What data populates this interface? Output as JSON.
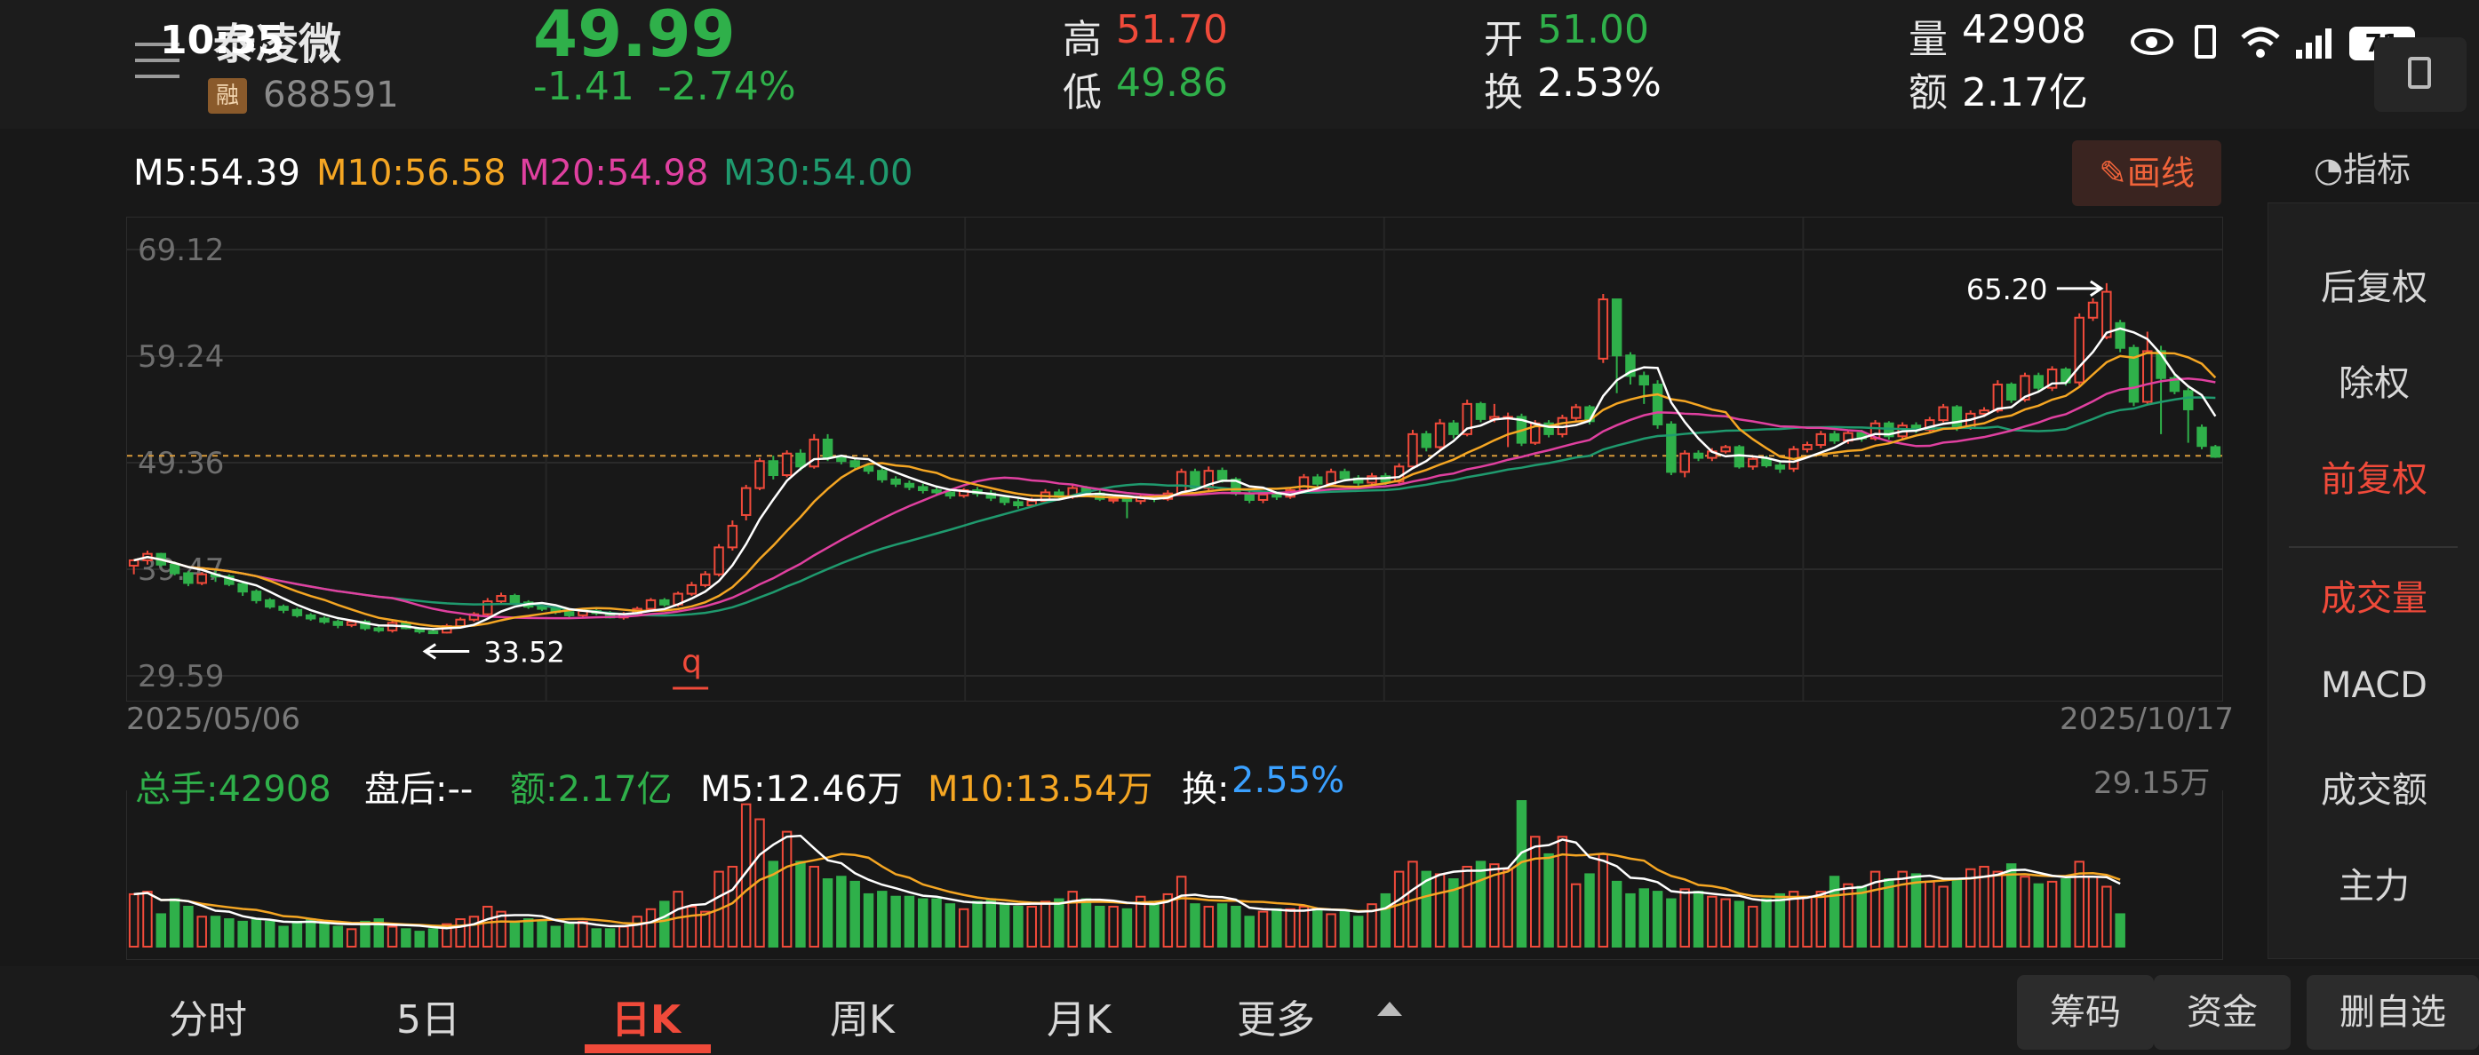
{
  "status_bar": {
    "time": "10:35",
    "battery": "71"
  },
  "stock": {
    "name": "泰凌微",
    "badge": "融",
    "code": "688591",
    "price": "49.99",
    "change": "-1.41",
    "change_pct": "-2.74%",
    "high_label": "高",
    "high": "51.70",
    "low_label": "低",
    "low": "49.86",
    "open_label": "开",
    "open": "51.00",
    "turnover_label": "换",
    "turnover": "2.53%",
    "volume_label": "量",
    "volume": "42908",
    "amount_label": "额",
    "amount": "2.17亿"
  },
  "ma_row": {
    "m5": "M5:54.39",
    "m10": "M10:56.58",
    "m20": "M20:54.98",
    "m30": "M30:54.00",
    "draw_btn": "画线",
    "indicator_btn": "指标"
  },
  "right_panel": [
    {
      "label": "后复权",
      "active": false
    },
    {
      "label": "除权",
      "active": false
    },
    {
      "label": "前复权",
      "active": true
    },
    {
      "label": "成交量",
      "active": true
    },
    {
      "label": "MACD",
      "active": false
    },
    {
      "label": "成交额",
      "active": false
    },
    {
      "label": "主力",
      "active": false
    }
  ],
  "chart_data": {
    "type": "candlestick",
    "y_ticks": [
      "69.12",
      "59.24",
      "49.36",
      "39.47",
      "29.59"
    ],
    "ylim": [
      29.59,
      69.12
    ],
    "start_date": "2025/05/06",
    "end_date": "2025/10/17",
    "max_label": "65.20",
    "min_label": "33.52",
    "marker_q": "q",
    "last_close": 49.99,
    "candles": [
      [
        39.8,
        40.3,
        39.0,
        40.4
      ],
      [
        40.3,
        40.9,
        39.9,
        41.2
      ],
      [
        40.9,
        39.9,
        39.7,
        41.0
      ],
      [
        39.9,
        39.1,
        38.9,
        40.2
      ],
      [
        39.1,
        38.2,
        37.9,
        39.3
      ],
      [
        38.2,
        39.0,
        38.0,
        39.2
      ],
      [
        39.0,
        38.8,
        38.3,
        39.4
      ],
      [
        38.8,
        38.1,
        37.9,
        39.0
      ],
      [
        38.1,
        37.4,
        37.0,
        38.3
      ],
      [
        37.4,
        36.6,
        36.3,
        37.6
      ],
      [
        36.6,
        36.0,
        35.8,
        36.8
      ],
      [
        36.0,
        35.7,
        35.4,
        36.2
      ],
      [
        35.7,
        35.2,
        35.0,
        35.9
      ],
      [
        35.2,
        34.9,
        34.7,
        35.4
      ],
      [
        34.9,
        34.6,
        34.4,
        35.1
      ],
      [
        34.6,
        34.3,
        34.0,
        34.8
      ],
      [
        34.3,
        34.6,
        34.1,
        34.8
      ],
      [
        34.6,
        34.0,
        33.8,
        34.8
      ],
      [
        34.0,
        33.8,
        33.6,
        34.2
      ],
      [
        33.8,
        34.5,
        33.6,
        34.7
      ],
      [
        34.5,
        34.0,
        33.9,
        34.7
      ],
      [
        34.0,
        33.7,
        33.5,
        34.1
      ],
      [
        33.7,
        33.6,
        33.5,
        33.9
      ],
      [
        33.6,
        34.2,
        33.52,
        34.4
      ],
      [
        34.2,
        34.8,
        34.0,
        35.0
      ],
      [
        34.8,
        35.3,
        34.6,
        35.5
      ],
      [
        35.3,
        36.5,
        35.1,
        36.8
      ],
      [
        36.5,
        37.0,
        36.2,
        37.3
      ],
      [
        37.0,
        36.4,
        36.2,
        37.2
      ],
      [
        36.4,
        36.0,
        35.8,
        36.6
      ],
      [
        36.0,
        35.8,
        35.6,
        36.2
      ],
      [
        35.8,
        35.5,
        35.3,
        36.0
      ],
      [
        35.5,
        35.2,
        35.0,
        35.7
      ],
      [
        35.2,
        35.6,
        35.0,
        35.8
      ],
      [
        35.6,
        35.4,
        35.2,
        35.8
      ],
      [
        35.4,
        35.0,
        34.9,
        35.6
      ],
      [
        35.0,
        35.3,
        34.8,
        35.5
      ],
      [
        35.3,
        35.8,
        35.1,
        36.0
      ],
      [
        35.8,
        36.6,
        35.6,
        36.8
      ],
      [
        36.6,
        36.2,
        36.0,
        36.8
      ],
      [
        36.2,
        37.2,
        36.0,
        37.4
      ],
      [
        37.2,
        38.0,
        37.0,
        38.3
      ],
      [
        38.0,
        39.0,
        37.8,
        39.3
      ],
      [
        39.0,
        41.5,
        38.8,
        41.8
      ],
      [
        41.5,
        43.5,
        41.2,
        44.0
      ],
      [
        44.5,
        47.0,
        44.0,
        47.3
      ],
      [
        47.0,
        49.5,
        46.8,
        49.8
      ],
      [
        49.5,
        48.2,
        47.8,
        50.0
      ],
      [
        48.2,
        50.2,
        48.0,
        50.5
      ],
      [
        50.2,
        49.0,
        48.6,
        50.6
      ],
      [
        49.0,
        51.5,
        48.8,
        52.0
      ],
      [
        51.5,
        49.8,
        49.5,
        52.0
      ],
      [
        49.8,
        49.5,
        49.2,
        50.1
      ],
      [
        49.5,
        49.0,
        48.8,
        49.8
      ],
      [
        49.0,
        48.6,
        48.3,
        49.3
      ],
      [
        48.6,
        47.8,
        47.5,
        48.9
      ],
      [
        47.8,
        47.4,
        47.1,
        48.1
      ],
      [
        47.4,
        47.1,
        46.8,
        47.7
      ],
      [
        47.1,
        46.8,
        46.5,
        47.4
      ],
      [
        46.8,
        46.6,
        46.3,
        47.1
      ],
      [
        46.6,
        46.3,
        46.0,
        46.9
      ],
      [
        46.3,
        46.8,
        46.1,
        47.0
      ],
      [
        46.8,
        46.5,
        46.2,
        47.1
      ],
      [
        46.5,
        46.1,
        45.8,
        46.8
      ],
      [
        46.1,
        45.7,
        45.4,
        46.3
      ],
      [
        45.7,
        45.4,
        45.1,
        46.0
      ],
      [
        45.4,
        45.8,
        45.2,
        46.1
      ],
      [
        45.8,
        46.6,
        45.6,
        46.9
      ],
      [
        46.6,
        46.2,
        46.0,
        46.9
      ],
      [
        46.2,
        47.0,
        46.0,
        47.3
      ],
      [
        47.0,
        46.5,
        46.2,
        47.2
      ],
      [
        46.5,
        46.0,
        45.8,
        46.8
      ],
      [
        46.0,
        46.0,
        45.6,
        46.3
      ],
      [
        46.0,
        45.8,
        44.2,
        46.1
      ],
      [
        45.8,
        46.2,
        45.5,
        46.4
      ],
      [
        46.2,
        46.0,
        45.7,
        46.4
      ],
      [
        46.0,
        46.5,
        45.8,
        46.8
      ],
      [
        46.5,
        48.5,
        46.3,
        48.8
      ],
      [
        48.5,
        47.0,
        46.8,
        48.8
      ],
      [
        47.0,
        48.6,
        46.8,
        49.0
      ],
      [
        48.6,
        47.8,
        47.5,
        48.9
      ],
      [
        47.8,
        46.5,
        46.3,
        48.0
      ],
      [
        46.5,
        45.9,
        45.6,
        46.8
      ],
      [
        45.9,
        46.4,
        45.6,
        46.7
      ],
      [
        46.4,
        46.2,
        45.9,
        46.6
      ],
      [
        46.2,
        46.8,
        46.0,
        47.1
      ],
      [
        46.8,
        48.0,
        46.6,
        48.3
      ],
      [
        48.0,
        47.4,
        47.1,
        48.3
      ],
      [
        47.4,
        48.5,
        47.2,
        48.8
      ],
      [
        48.5,
        47.9,
        47.6,
        48.8
      ],
      [
        47.9,
        47.5,
        47.2,
        48.2
      ],
      [
        47.5,
        48.1,
        47.2,
        48.4
      ],
      [
        48.1,
        47.6,
        47.3,
        48.4
      ],
      [
        47.6,
        49.0,
        47.4,
        49.3
      ],
      [
        49.0,
        52.0,
        48.8,
        52.4
      ],
      [
        52.0,
        50.8,
        50.4,
        52.3
      ],
      [
        50.8,
        53.0,
        50.6,
        53.4
      ],
      [
        53.0,
        52.0,
        51.6,
        53.3
      ],
      [
        52.0,
        54.8,
        51.8,
        55.2
      ],
      [
        54.8,
        53.4,
        53.1,
        55.0
      ],
      [
        53.4,
        53.6,
        53.1,
        54.8
      ],
      [
        53.6,
        53.6,
        50.8,
        54.0
      ],
      [
        53.6,
        51.2,
        50.9,
        53.9
      ],
      [
        51.2,
        53.0,
        51.0,
        53.3
      ],
      [
        53.0,
        52.0,
        51.7,
        53.3
      ],
      [
        52.0,
        53.5,
        51.7,
        53.8
      ],
      [
        53.5,
        54.5,
        53.2,
        54.8
      ],
      [
        54.5,
        53.2,
        52.9,
        54.7
      ],
      [
        59.0,
        64.5,
        58.6,
        65.0
      ],
      [
        64.5,
        59.3,
        55.8,
        61.0
      ],
      [
        59.3,
        57.4,
        56.6,
        59.6
      ],
      [
        57.4,
        56.6,
        54.8,
        57.8
      ],
      [
        56.6,
        52.9,
        52.5,
        57.0
      ],
      [
        52.9,
        48.5,
        48.2,
        53.2
      ],
      [
        48.5,
        50.2,
        48.0,
        50.5
      ],
      [
        50.2,
        49.8,
        49.5,
        50.5
      ],
      [
        49.8,
        50.4,
        49.5,
        50.7
      ],
      [
        50.4,
        50.8,
        50.2,
        51.0
      ],
      [
        50.8,
        49.0,
        48.8,
        51.0
      ],
      [
        49.0,
        49.7,
        48.7,
        50.0
      ],
      [
        49.7,
        49.1,
        48.9,
        50.0
      ],
      [
        49.1,
        48.8,
        48.4,
        49.4
      ],
      [
        48.8,
        50.6,
        48.5,
        50.9
      ],
      [
        50.6,
        51.0,
        50.3,
        51.3
      ],
      [
        51.0,
        52.0,
        50.7,
        52.3
      ],
      [
        52.0,
        51.4,
        51.1,
        52.3
      ],
      [
        51.4,
        52.1,
        51.1,
        52.4
      ],
      [
        52.1,
        51.6,
        51.3,
        52.4
      ],
      [
        51.6,
        53.0,
        51.4,
        53.3
      ],
      [
        53.0,
        51.8,
        51.5,
        53.2
      ],
      [
        51.8,
        52.8,
        51.5,
        53.1
      ],
      [
        52.8,
        52.4,
        52.1,
        53.1
      ],
      [
        52.4,
        53.3,
        52.1,
        53.6
      ],
      [
        53.3,
        54.5,
        53.1,
        54.8
      ],
      [
        54.5,
        52.6,
        52.3,
        54.7
      ],
      [
        52.6,
        53.9,
        52.4,
        54.2
      ],
      [
        53.9,
        54.2,
        53.6,
        54.5
      ],
      [
        54.2,
        56.6,
        54.0,
        57.0
      ],
      [
        56.6,
        55.2,
        54.9,
        56.8
      ],
      [
        55.2,
        57.4,
        55.0,
        57.7
      ],
      [
        57.4,
        56.3,
        56.0,
        57.7
      ],
      [
        56.3,
        58.0,
        56.0,
        58.3
      ],
      [
        58.0,
        56.8,
        56.5,
        58.2
      ],
      [
        56.8,
        62.8,
        56.5,
        63.2
      ],
      [
        62.8,
        64.2,
        62.5,
        64.6
      ],
      [
        61.0,
        65.2,
        60.8,
        66.0
      ],
      [
        62.3,
        60.0,
        59.6,
        62.6
      ],
      [
        60.0,
        55.0,
        54.6,
        60.3
      ],
      [
        55.0,
        59.7,
        54.8,
        61.5
      ],
      [
        59.7,
        57.2,
        52.0,
        60.2
      ],
      [
        57.2,
        56.0,
        55.7,
        57.5
      ],
      [
        56.0,
        54.3,
        51.2,
        56.3
      ],
      [
        52.6,
        50.9,
        50.6,
        52.9
      ],
      [
        50.8,
        49.9,
        49.8,
        51.0
      ]
    ],
    "volume": {
      "total": "总手:42908",
      "after_hours": "盘后:--",
      "amount": "额:2.17亿",
      "m5": "M5:12.46万",
      "m10": "M10:13.54万",
      "turnover_label": "换:",
      "turnover": "2.55%",
      "max_label": "29.15万"
    },
    "volumes": [
      10.5,
      11.0,
      6.5,
      9.5,
      8.0,
      6.0,
      6.0,
      5.5,
      5.0,
      5.5,
      5.0,
      4.0,
      5.0,
      5.5,
      4.5,
      4.0,
      3.5,
      5.0,
      5.5,
      4.0,
      3.5,
      3.0,
      3.5,
      4.5,
      5.5,
      6.0,
      8.0,
      7.0,
      5.0,
      5.5,
      5.0,
      4.0,
      4.5,
      5.0,
      3.5,
      3.5,
      4.0,
      6.0,
      7.5,
      9.0,
      11.0,
      8.0,
      7.0,
      15.0,
      16.0,
      28.5,
      25.5,
      17.0,
      23.0,
      17.0,
      16.0,
      13.5,
      14.0,
      13.0,
      10.5,
      11.0,
      10.0,
      10.0,
      9.5,
      9.5,
      8.5,
      7.5,
      9.0,
      9.5,
      8.5,
      8.0,
      8.0,
      9.0,
      9.5,
      11.0,
      9.5,
      8.0,
      8.0,
      7.5,
      10.0,
      9.0,
      10.5,
      14.0,
      8.5,
      8.0,
      8.5,
      8.0,
      6.0,
      7.0,
      7.5,
      7.5,
      8.0,
      7.5,
      6.5,
      7.0,
      6.0,
      8.5,
      10.5,
      15.0,
      17.0,
      15.0,
      14.5,
      13.5,
      16.0,
      17.0,
      16.5,
      15.5,
      29.15,
      22.0,
      18.5,
      22.0,
      12.5,
      14.5,
      18.5,
      13.0,
      10.5,
      11.5,
      11.0,
      9.5,
      11.5,
      11.0,
      10.0,
      9.5,
      9.0,
      8.0,
      9.5,
      10.5,
      11.0,
      10.0,
      11.0,
      14.0,
      12.5,
      12.0,
      15.0,
      13.5,
      15.0,
      14.5,
      13.0,
      12.0,
      13.5,
      15.5,
      16.0,
      15.0,
      16.5,
      14.0,
      12.5,
      13.0,
      13.5,
      17.0,
      14.0,
      12.0,
      6.5
    ]
  },
  "tabs": [
    {
      "label": "分时",
      "active": false
    },
    {
      "label": "5日",
      "active": false
    },
    {
      "label": "日K",
      "active": true
    },
    {
      "label": "周K",
      "active": false
    },
    {
      "label": "月K",
      "active": false
    },
    {
      "label": "更多",
      "active": false
    }
  ],
  "bottom_buttons": {
    "chips": "筹码",
    "funds": "资金",
    "delete_watch": "删自选"
  },
  "colors": {
    "up": "#f04a3a",
    "down": "#2fb04a",
    "ma5": "#ffffff",
    "ma10": "#f5a623",
    "ma20": "#e040a0",
    "ma30": "#1f9a6e"
  }
}
